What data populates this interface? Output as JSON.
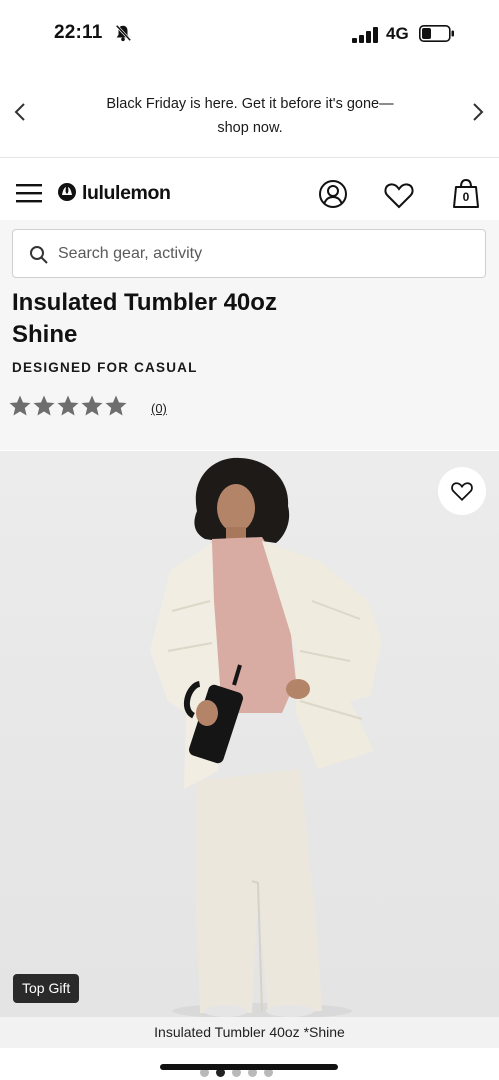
{
  "status_bar": {
    "time": "22:11",
    "network": "4G"
  },
  "promo": {
    "text_line1": "Black Friday is here. Get it before it's gone—",
    "text_line2": "shop now."
  },
  "header": {
    "brand": "lululemon",
    "bag_count": "0"
  },
  "search": {
    "placeholder": "Search gear, activity"
  },
  "product": {
    "title_line1": "Insulated Tumbler 40oz",
    "title_line2": "Shine",
    "category": "DESIGNED FOR CASUAL",
    "rating": 0,
    "rating_max": 5,
    "review_count": "(0)",
    "badge": "Top Gift",
    "image_caption": "Insulated Tumbler 40oz *Shine"
  },
  "carousel": {
    "total": 5,
    "current": 2
  },
  "colors": {
    "star_empty": "#6e6e6e",
    "page_bg": "#f6f6f6",
    "badge_bg": "#2a2a2a"
  },
  "icons": [
    "bell-muted-icon",
    "signal-icon",
    "battery-icon",
    "chevron-left-icon",
    "chevron-right-icon",
    "menu-icon",
    "lululemon-logo-icon",
    "account-icon",
    "heart-icon",
    "shopping-bag-icon",
    "search-icon",
    "star-icon"
  ]
}
